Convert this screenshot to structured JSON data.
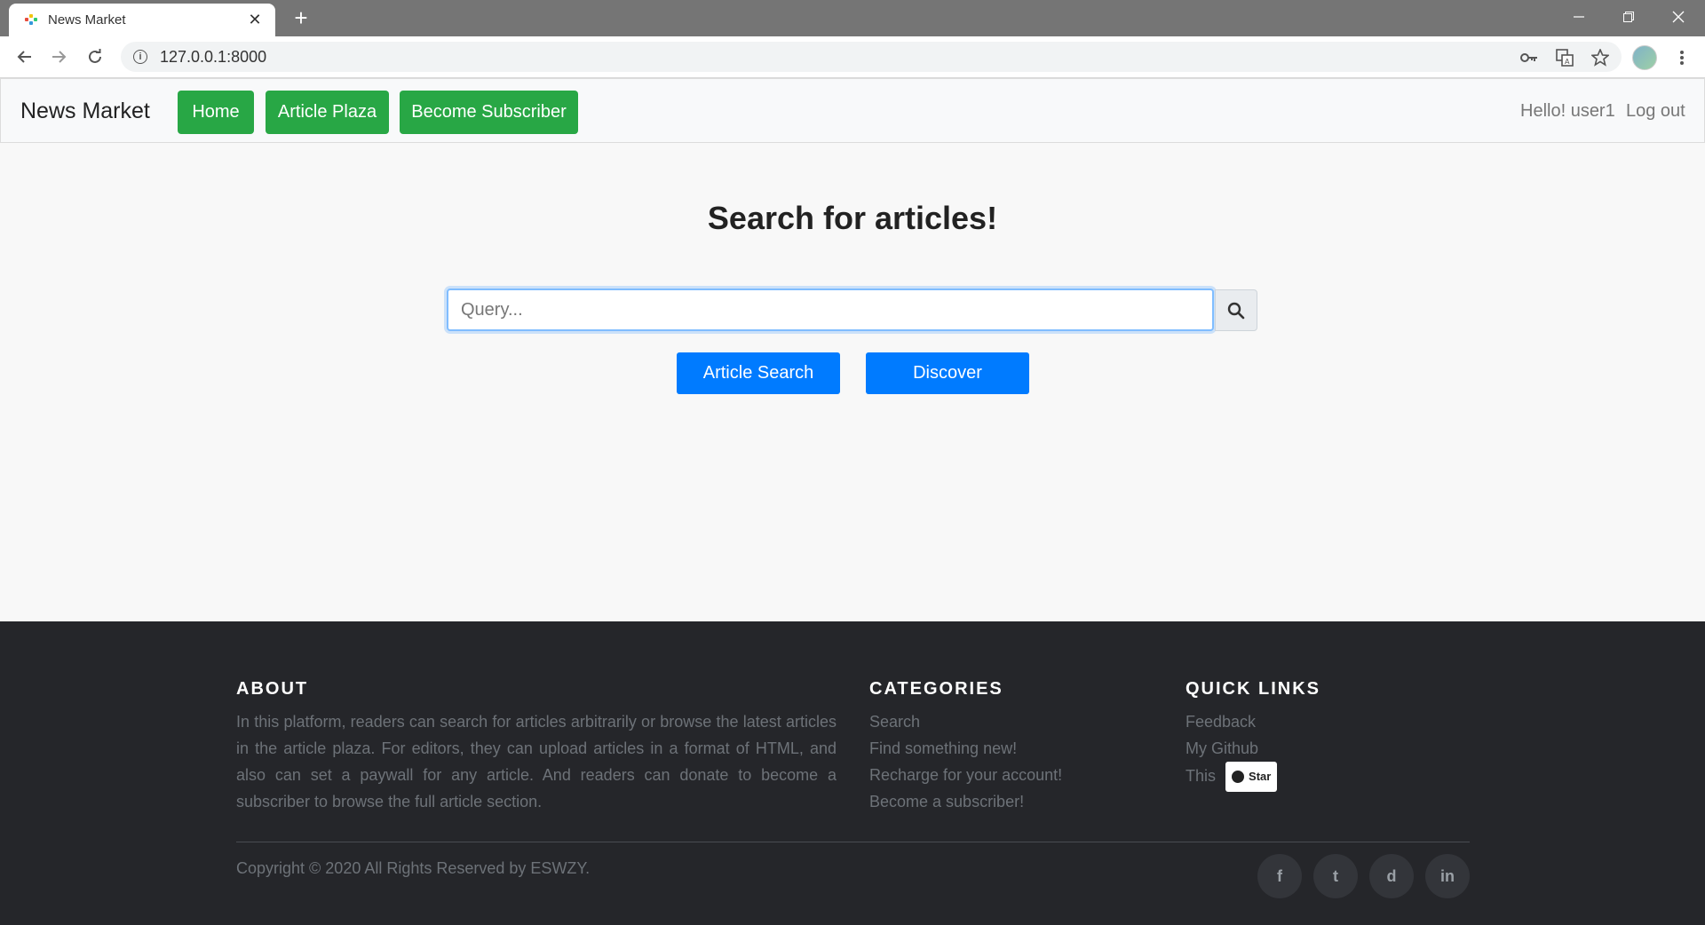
{
  "browser": {
    "tab_title": "News Market",
    "tab_close": "✕",
    "new_tab": "+",
    "url": "127.0.0.1:8000",
    "icons": [
      "back-arrow-icon",
      "forward-arrow-icon",
      "reload-icon",
      "info-icon",
      "key-icon",
      "translate-icon",
      "star-icon",
      "menu-dots-icon"
    ],
    "window_controls": [
      "minimize-icon",
      "restore-icon",
      "close-icon"
    ]
  },
  "navbar": {
    "brand": "News Market",
    "links": [
      "Home",
      "Article Plaza",
      "Become Subscriber"
    ],
    "greeting": "Hello! user1",
    "logout": "Log out",
    "accent": "#28a745"
  },
  "main": {
    "title": "Search for articles!",
    "search_placeholder": "Query...",
    "buttons": [
      "Article Search",
      "Discover"
    ],
    "button_color": "#007bff"
  },
  "footer": {
    "about": {
      "heading": "ABOUT",
      "text": "In this platform, readers can search for articles arbitrarily or browse the latest articles in the article plaza. For editors, they can upload articles in a format of HTML, and also can set a paywall for any article. And readers can donate to become a subscriber to browse the full article section."
    },
    "categories": {
      "heading": "CATEGORIES",
      "items": [
        "Search",
        "Find something new!",
        "Recharge for your account!",
        "Become a subscriber!"
      ]
    },
    "quick_links": {
      "heading": "QUICK LINKS",
      "items": [
        "Feedback",
        "My Github",
        "This"
      ],
      "star_label": "Star"
    },
    "copyright": "Copyright © 2020 All Rights Reserved by ESWZY.",
    "social": [
      "f",
      "t",
      "d",
      "in"
    ]
  }
}
